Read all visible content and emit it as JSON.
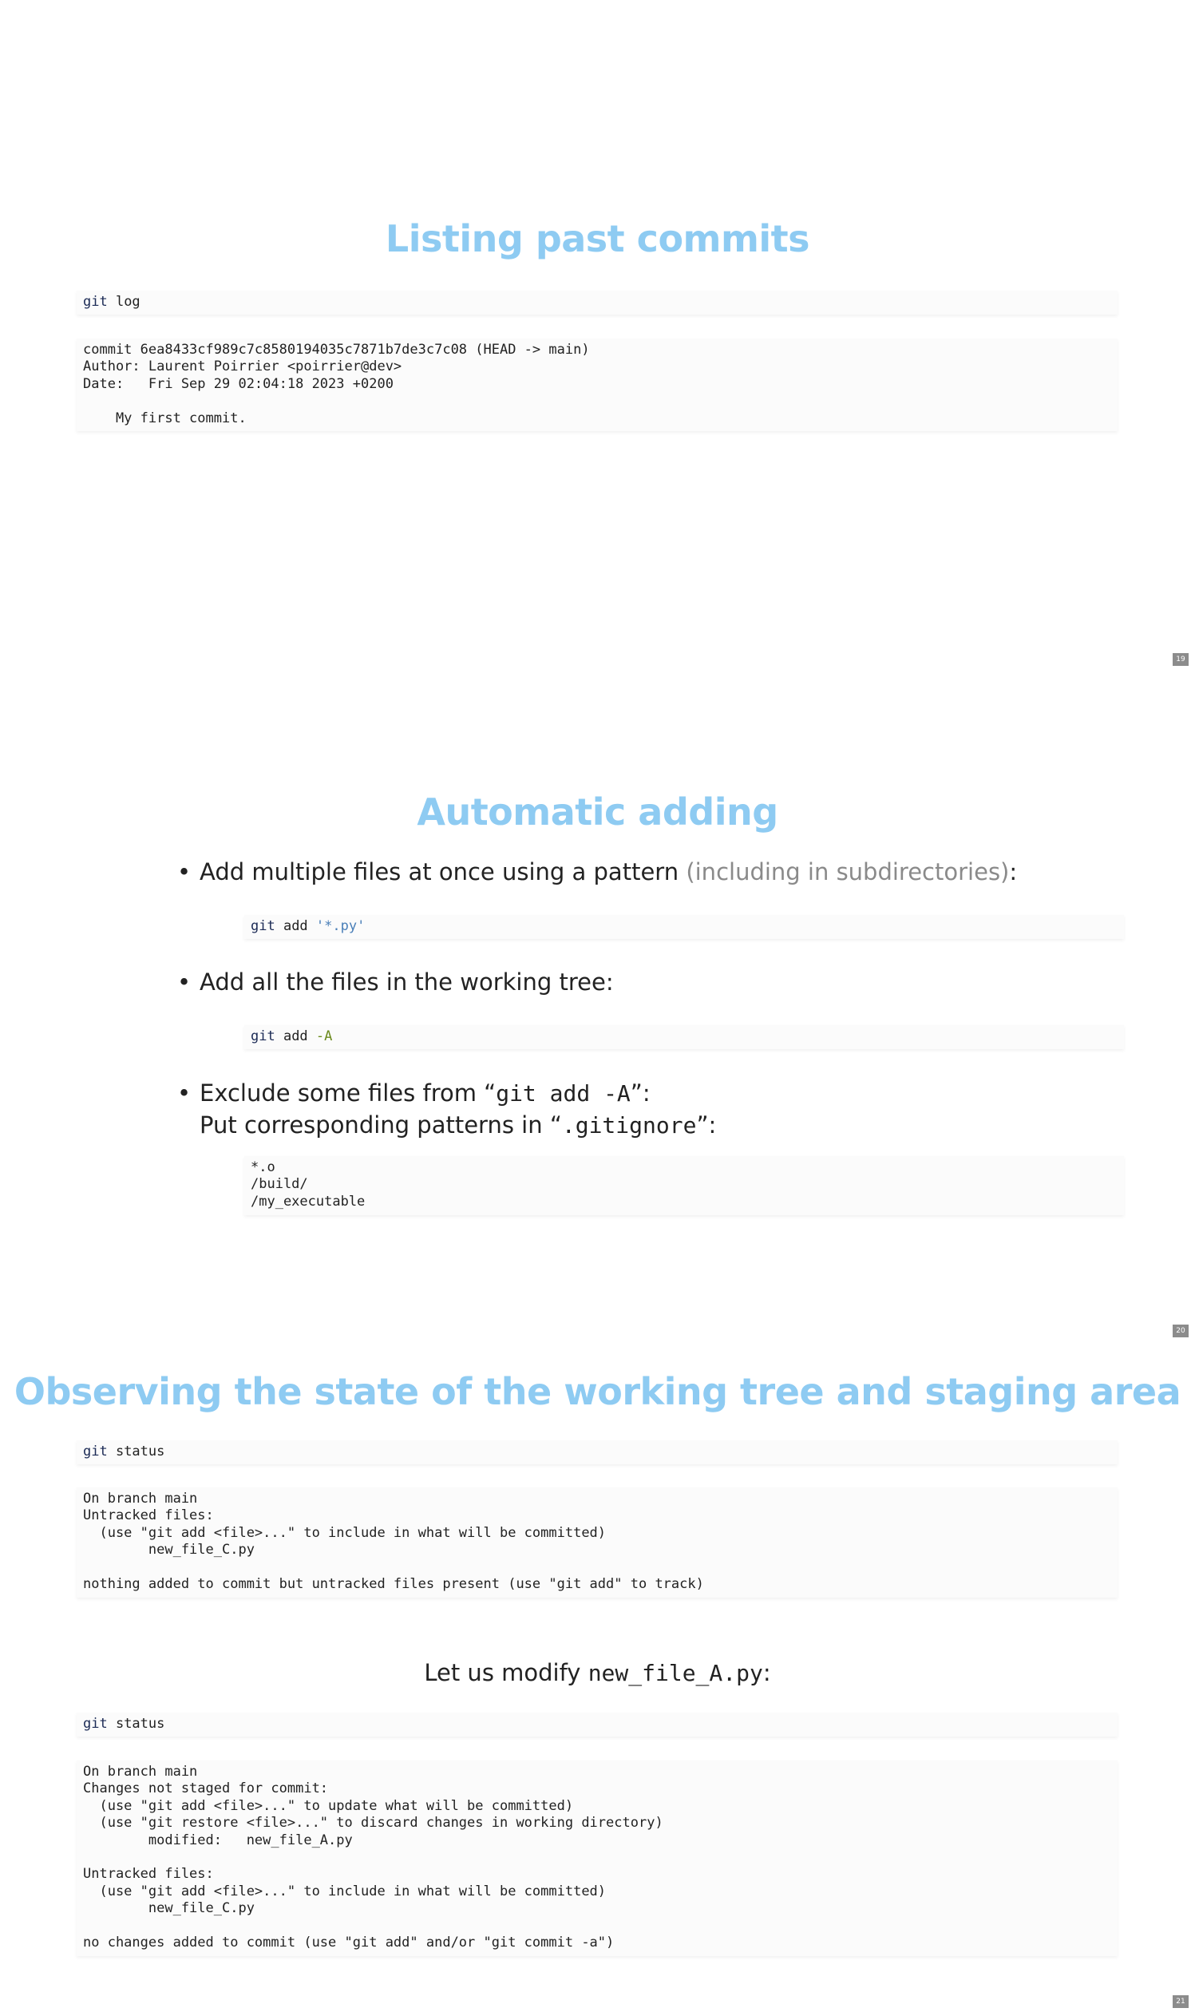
{
  "slides": [
    {
      "number": "19",
      "title": "Listing past commits",
      "command": {
        "kw": "git",
        "rest": " log"
      },
      "output": [
        "commit 6ea8433cf989c7c8580194035c7871b7de3c7c08 (HEAD -> main)",
        "Author: Laurent Poirrier <poirrier@dev>",
        "Date:   Fri Sep 29 02:04:18 2023 +0200",
        "",
        "    My first commit."
      ]
    },
    {
      "number": "20",
      "title": "Automatic adding",
      "bullets": [
        {
          "text": "Add multiple files at once using a pattern ",
          "muted": "(including in subdirectories)",
          "tail": ":"
        },
        {
          "text": "Add all the files in the working tree:"
        },
        {
          "line1_pre": "Exclude some files from “",
          "line1_code": "git add -A",
          "line1_post": "”:",
          "line2_pre": "Put corresponding patterns in “",
          "line2_code": ".gitignore",
          "line2_post": "”:"
        }
      ],
      "code_pattern": {
        "kw": "git",
        "mid": " add ",
        "arg": "'*.py'"
      },
      "code_all": {
        "kw": "git",
        "mid": " add ",
        "arg": "-A"
      },
      "gitignore": [
        "*.o",
        "/build/",
        "/my_executable"
      ]
    },
    {
      "number": "21",
      "title": "Observing the state of the working tree and staging area",
      "command1": {
        "kw": "git",
        "rest": " status"
      },
      "output1": [
        "On branch main",
        "Untracked files:",
        "  (use \"git add <file>...\" to include in what will be committed)",
        "        new_file_C.py",
        "",
        "nothing added to commit but untracked files present (use \"git add\" to track)"
      ],
      "middle_text_pre": "Let us modify ",
      "middle_text_code": "new_file_A.py",
      "middle_text_post": ":",
      "command2": {
        "kw": "git",
        "rest": " status"
      },
      "output2": [
        "On branch main",
        "Changes not staged for commit:",
        "  (use \"git add <file>...\" to update what will be committed)",
        "  (use \"git restore <file>...\" to discard changes in working directory)",
        "        modified:   new_file_A.py",
        "",
        "Untracked files:",
        "  (use \"git add <file>...\" to include in what will be committed)",
        "        new_file_C.py",
        "",
        "no changes added to commit (use \"git add\" and/or \"git commit -a\")"
      ]
    }
  ]
}
